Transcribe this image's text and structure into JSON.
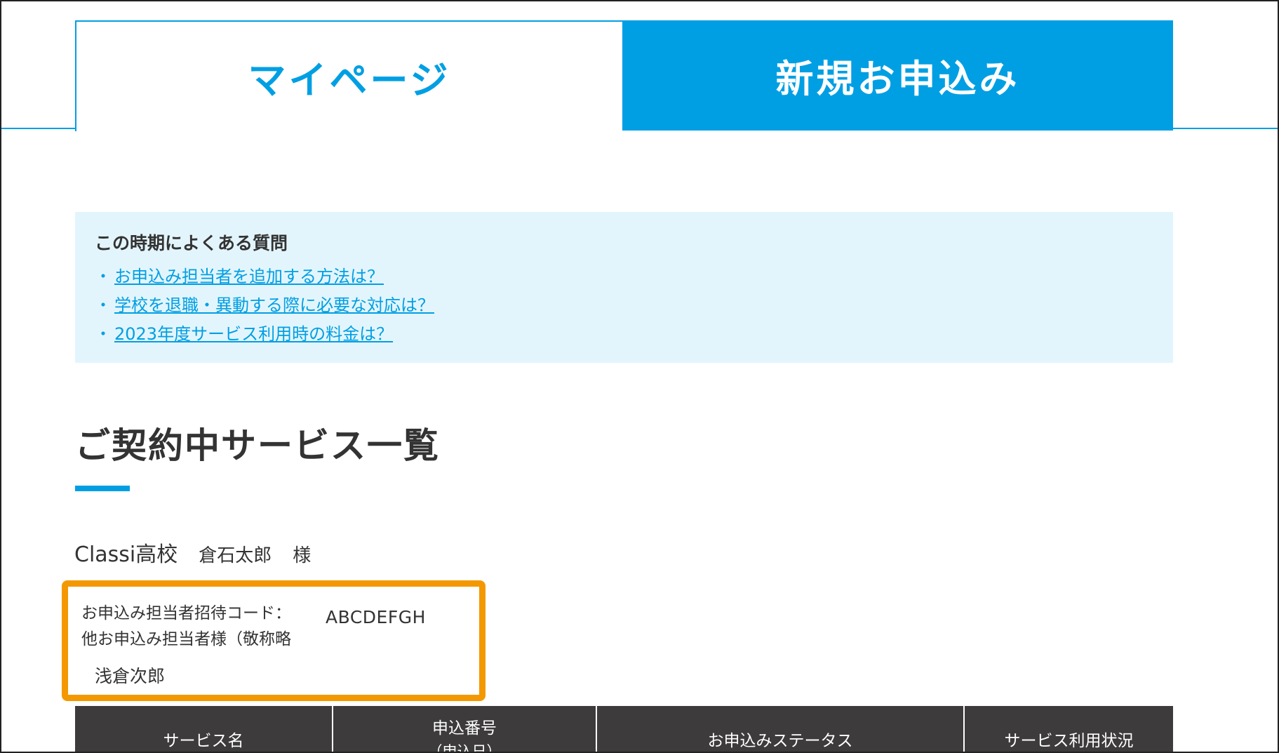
{
  "tabs": {
    "mypage": "マイページ",
    "new_application": "新規お申込み"
  },
  "faq": {
    "title": "この時期によくある質問",
    "bullet": "・",
    "items": [
      {
        "text": "お申込み担当者を追加する方法は？"
      },
      {
        "text": "学校を退職・異動する際に必要な対応は？"
      },
      {
        "text": "2023年度サービス利用時の料金は？"
      }
    ]
  },
  "section": {
    "title": "ご契約中サービス一覧"
  },
  "customer": {
    "school": "Classi高校",
    "name": "倉石太郎",
    "honorific": "様"
  },
  "invite": {
    "code_label": "お申込み担当者招待コード：",
    "code_value": "ABCDEFGH",
    "others_label": "他お申込み担当者様（敬称略",
    "others_name": "浅倉次郎"
  },
  "table": {
    "columns": [
      {
        "label": "サービス名"
      },
      {
        "label": "申込番号",
        "sub": "（申込日）"
      },
      {
        "label": "お申込みステータス"
      },
      {
        "label": "サービス利用状況"
      }
    ]
  },
  "colors": {
    "accent": "#009fe3",
    "faq_background": "#e3f5fc",
    "highlight": "#f39800",
    "table_header": "#3d3b3b"
  }
}
